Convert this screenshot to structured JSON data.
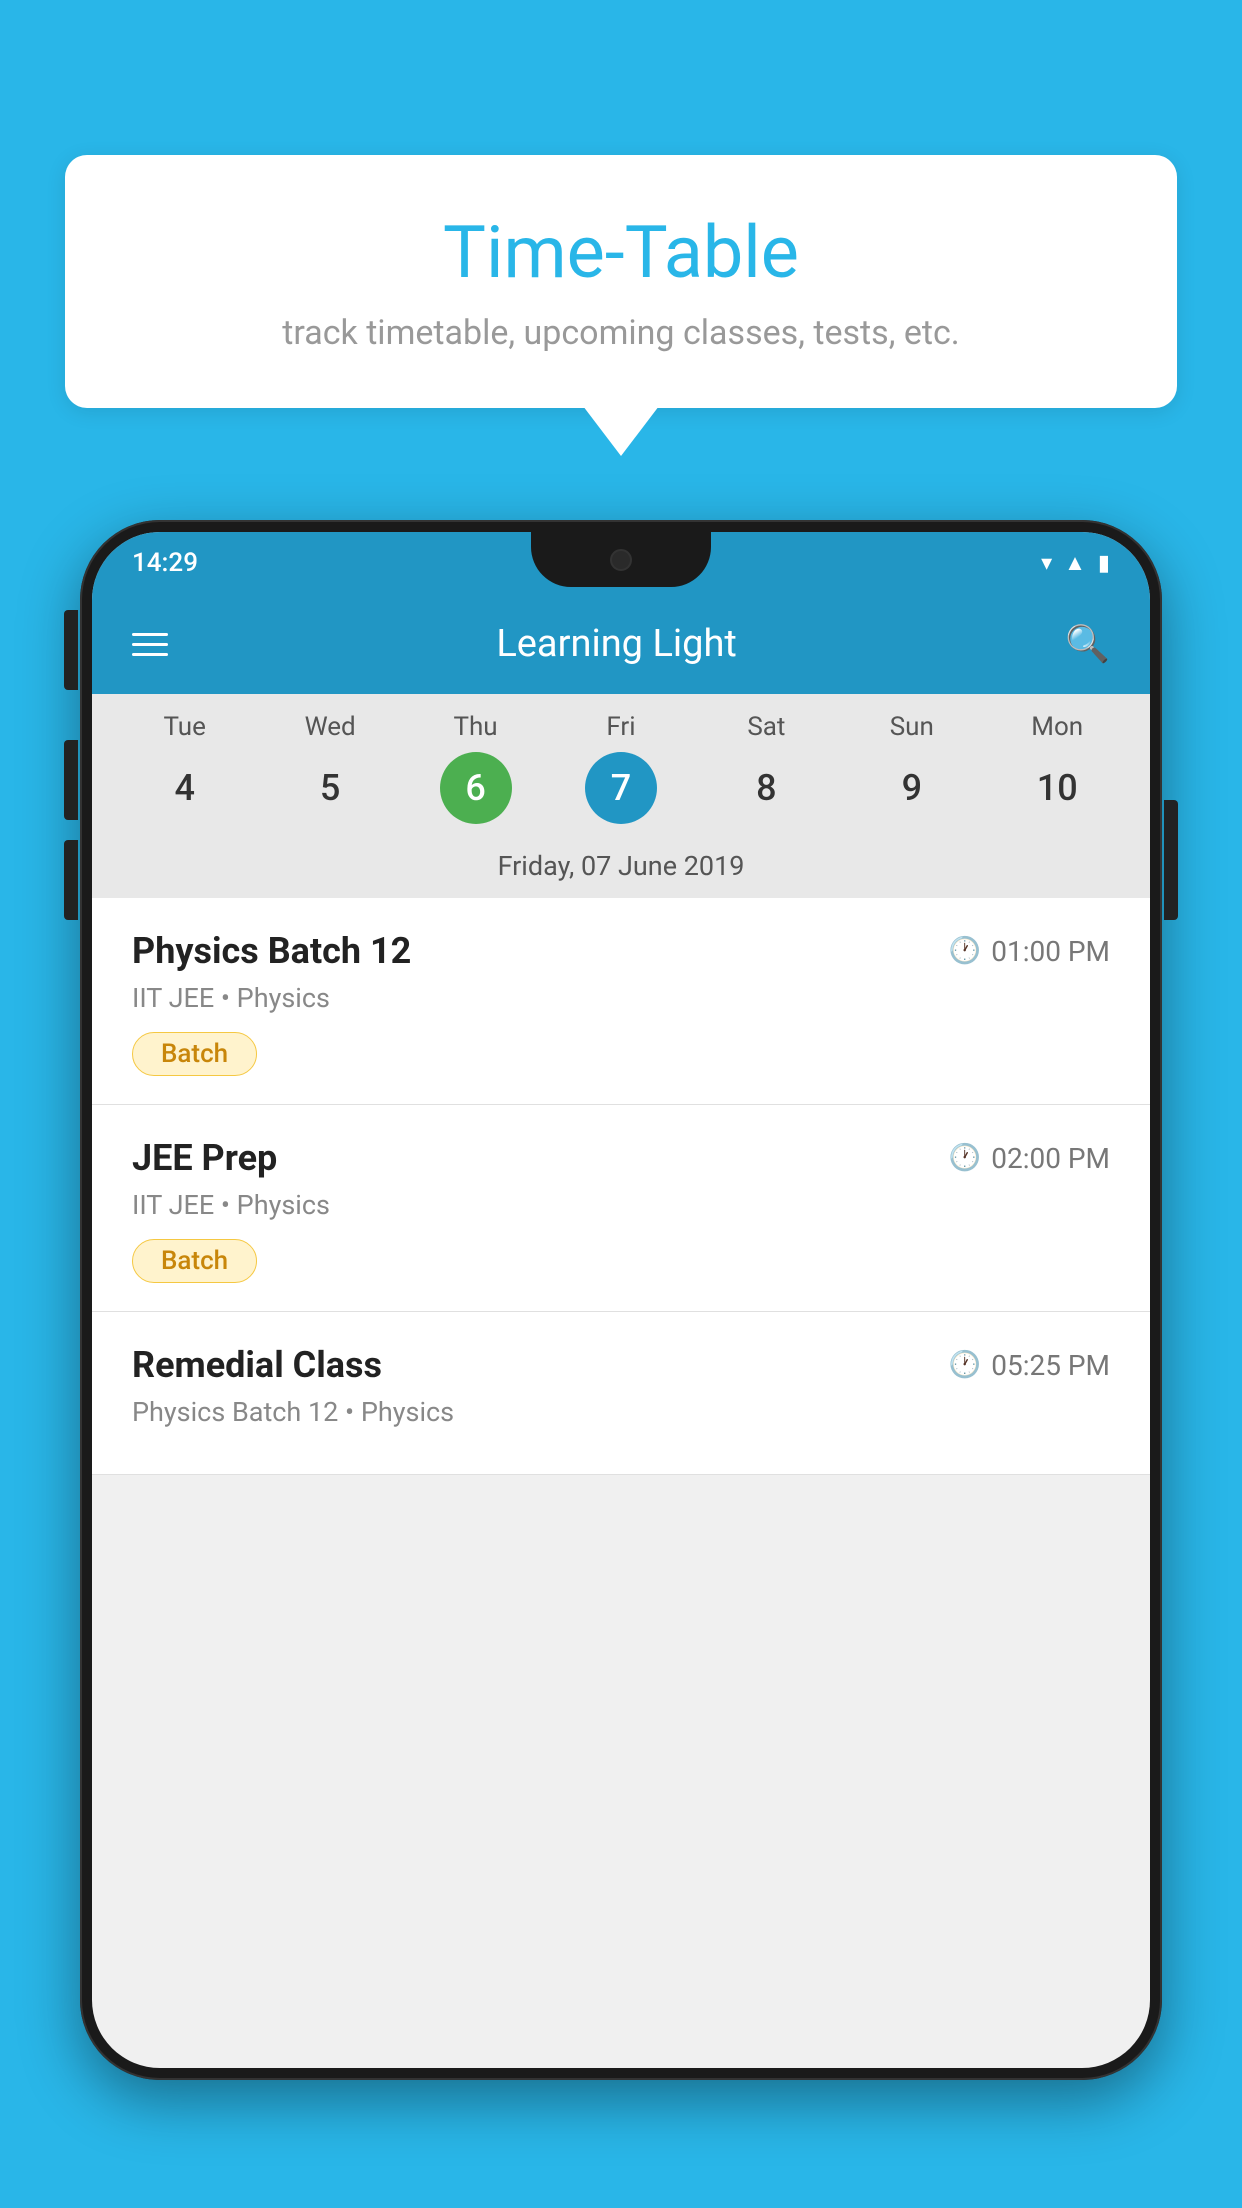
{
  "page": {
    "background_color": "#29B6E8"
  },
  "speech_bubble": {
    "title": "Time-Table",
    "subtitle": "track timetable, upcoming classes, tests, etc."
  },
  "phone": {
    "status_bar": {
      "time": "14:29"
    },
    "app_header": {
      "title": "Learning Light"
    },
    "calendar": {
      "days": [
        {
          "name": "Tue",
          "num": "4",
          "state": "normal"
        },
        {
          "name": "Wed",
          "num": "5",
          "state": "normal"
        },
        {
          "name": "Thu",
          "num": "6",
          "state": "today"
        },
        {
          "name": "Fri",
          "num": "7",
          "state": "selected"
        },
        {
          "name": "Sat",
          "num": "8",
          "state": "normal"
        },
        {
          "name": "Sun",
          "num": "9",
          "state": "normal"
        },
        {
          "name": "Mon",
          "num": "10",
          "state": "normal"
        }
      ],
      "selected_date_label": "Friday, 07 June 2019"
    },
    "classes": [
      {
        "name": "Physics Batch 12",
        "time": "01:00 PM",
        "info": "IIT JEE • Physics",
        "badge": "Batch"
      },
      {
        "name": "JEE Prep",
        "time": "02:00 PM",
        "info": "IIT JEE • Physics",
        "badge": "Batch"
      },
      {
        "name": "Remedial Class",
        "time": "05:25 PM",
        "info": "Physics Batch 12 • Physics",
        "badge": ""
      }
    ]
  }
}
